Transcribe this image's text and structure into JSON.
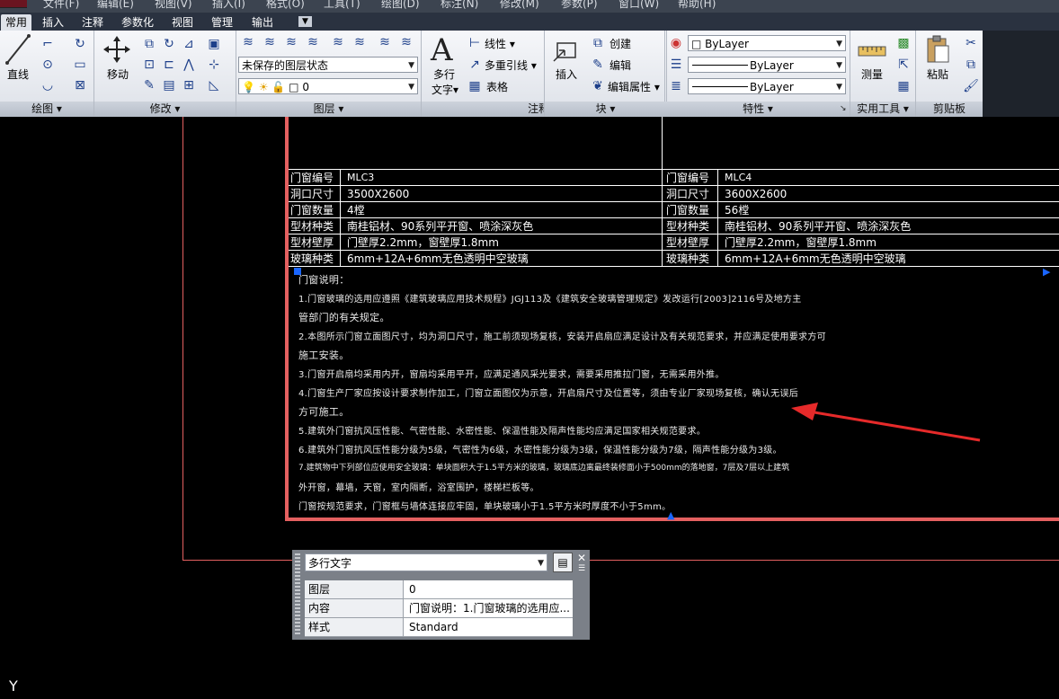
{
  "menubar": {
    "items": [
      "文件(F)",
      "编辑(E)",
      "视图(V)",
      "插入(I)",
      "格式(O)",
      "工具(T)",
      "绘图(D)",
      "标注(N)",
      "修改(M)",
      "参数(P)",
      "窗口(W)",
      "帮助(H)"
    ]
  },
  "tabs": [
    "常用",
    "插入",
    "注释",
    "参数化",
    "视图",
    "管理",
    "输出"
  ],
  "ribbon": {
    "draw": {
      "title": "绘图",
      "line_label": "直线"
    },
    "modify": {
      "title": "修改",
      "move_label": "移动"
    },
    "layers": {
      "title": "图层",
      "state_value": "未保存的图层状态",
      "layer_value": "0"
    },
    "annotation": {
      "title": "注释",
      "mtext_label1": "多行",
      "mtext_label2": "文字",
      "linear": "线性",
      "mleader": "多重引线",
      "table": "表格"
    },
    "block": {
      "title": "块",
      "insert": "插入",
      "create": "创建",
      "edit": "编辑",
      "edit_attr": "编辑属性"
    },
    "properties": {
      "title": "特性",
      "color": "ByLayer",
      "linetype": "ByLayer",
      "lineweight": "ByLayer"
    },
    "utilities": {
      "title": "实用工具",
      "measure": "测量"
    },
    "clipboard": {
      "title": "剪贴板",
      "paste": "粘贴"
    }
  },
  "table": {
    "left": [
      {
        "k": "门窗编号",
        "v": "MLC3"
      },
      {
        "k": "洞口尺寸",
        "v": "3500X2600"
      },
      {
        "k": "门窗数量",
        "v": "4樘"
      },
      {
        "k": "型材种类",
        "v": "南桂铝材、90系列平开窗、喷涂深灰色"
      },
      {
        "k": "型材壁厚",
        "v": "门壁厚2.2mm，窗壁厚1.8mm"
      },
      {
        "k": "玻璃种类",
        "v": "6mm+12A+6mm无色透明中空玻璃"
      }
    ],
    "right": [
      {
        "k": "门窗编号",
        "v": "MLC4"
      },
      {
        "k": "洞口尺寸",
        "v": "3600X2600"
      },
      {
        "k": "门窗数量",
        "v": "56樘"
      },
      {
        "k": "型材种类",
        "v": "南桂铝材、90系列平开窗、喷涂深灰色"
      },
      {
        "k": "型材壁厚",
        "v": "门壁厚2.2mm，窗壁厚1.8mm"
      },
      {
        "k": "玻璃种类",
        "v": "6mm+12A+6mm无色透明中空玻璃"
      }
    ]
  },
  "notes": [
    "门窗说明：",
    "1.门窗玻璃的选用应遵照《建筑玻璃应用技术规程》JGJ113及《建筑安全玻璃管理规定》发改运行[2003]2116号及地方主",
    "管部门的有关规定。",
    "2.本图所示门窗立面图尺寸，均为洞口尺寸，施工前须现场复核，安装开启扇应满足设计及有关规范要求，并应满足使用要求方可",
    "施工安装。",
    "3.门窗开启扇均采用内开，窗扇均采用平开，应满足通风采光要求，需要采用推拉门窗，无需采用外推。",
    "4.门窗生产厂家应按设计要求制作加工，门窗立面图仅为示意，开启扇尺寸及位置等，须由专业厂家现场复核，确认无误后",
    "方可施工。",
    "5.建筑外门窗抗风压性能、气密性能、水密性能、保温性能及隔声性能均应满足国家相关规范要求。",
    "6.建筑外门窗抗风压性能分级为5级，气密性为6级，水密性能分级为3级，保温性能分级为7级，隔声性能分级为3级。",
    "7.建筑物中下列部位应使用安全玻璃：单块面积大于1.5平方米的玻璃，玻璃底边离最终装修面小于500mm的落地窗，7层及7层以上建筑",
    "外开窗，幕墙，天窗，室内隔断，浴室围护，楼梯栏板等。",
    "门窗按规范要求，门窗框与墙体连接应牢固，单块玻璃小于1.5平方米时厚度不小于5mm。"
  ],
  "props": {
    "type": "多行文字",
    "rows": [
      {
        "k": "图层",
        "v": "0"
      },
      {
        "k": "内容",
        "v": "门窗说明：1.门窗玻璃的选用应..."
      },
      {
        "k": "样式",
        "v": "Standard"
      }
    ]
  },
  "axis_label": "Y",
  "colors": {
    "frame": "#e46060",
    "arrow": "#e62a2a",
    "grip": "#1a66ff"
  }
}
